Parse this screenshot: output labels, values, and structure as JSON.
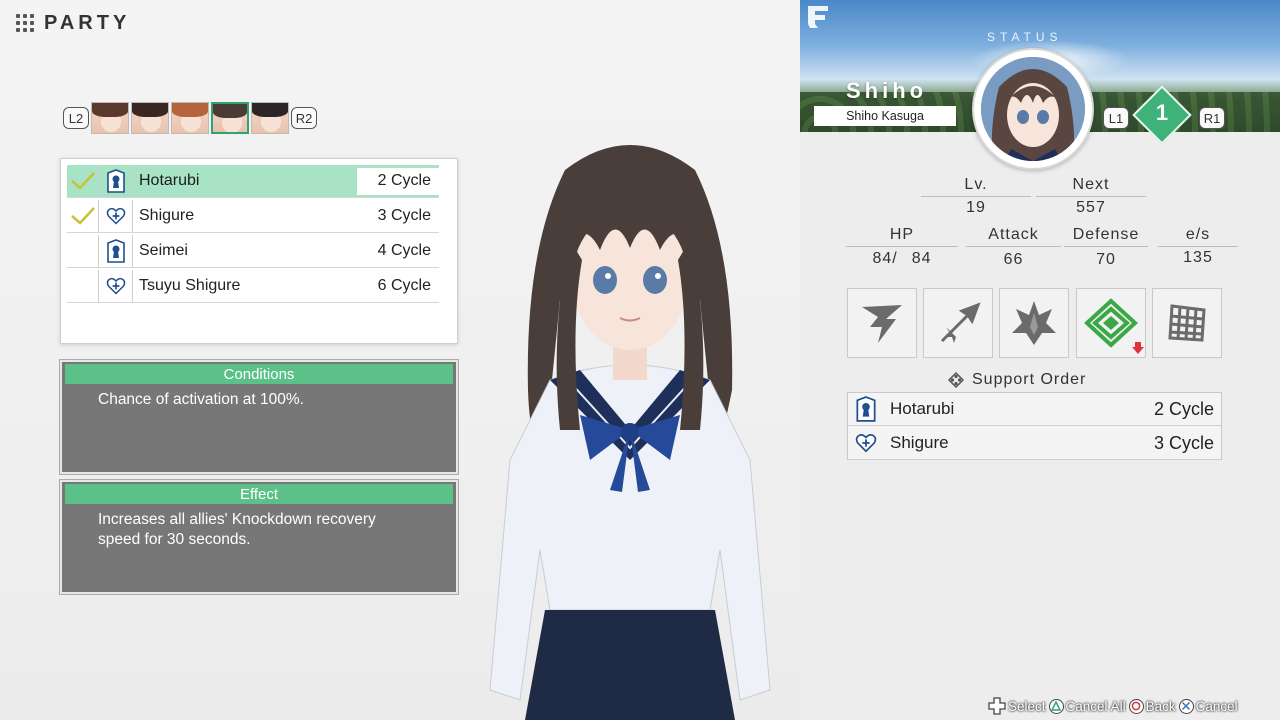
{
  "header": {
    "title": "PARTY",
    "icon": "grid-menu-icon"
  },
  "party": {
    "left_button": "L2",
    "right_button": "R2",
    "members": [
      {
        "hair": "#5b3a2c",
        "selected": false
      },
      {
        "hair": "#3a2722",
        "selected": false
      },
      {
        "hair": "#b4653d",
        "selected": false
      },
      {
        "hair": "#4a3b36",
        "selected": true
      },
      {
        "hair": "#2a2628",
        "selected": false
      }
    ]
  },
  "order_list": [
    {
      "name": "Hotarubi",
      "cycle": "2 Cycle",
      "checked": true,
      "active": true,
      "icon": "keyhole-tag-icon"
    },
    {
      "name": "Shigure",
      "cycle": "3 Cycle",
      "checked": true,
      "active": false,
      "icon": "heart-plus-icon"
    },
    {
      "name": "Seimei",
      "cycle": "4 Cycle",
      "checked": false,
      "active": false,
      "icon": "keyhole-tag-icon"
    },
    {
      "name": "Tsuyu Shigure",
      "cycle": "6 Cycle",
      "checked": false,
      "active": false,
      "icon": "heart-plus-icon"
    }
  ],
  "conditions": {
    "title": "Conditions",
    "text": "Chance of activation at 100%."
  },
  "effect": {
    "title": "Effect",
    "text": "Increases all allies' Knockdown recovery speed for 30 seconds."
  },
  "status": {
    "label": "STATUS",
    "name": "Shiho",
    "full_name": "Shiho Kasuga",
    "l_button": "L1",
    "r_button": "R1",
    "party_slot": "1",
    "lv_label": "Lv.",
    "lv": "19",
    "next_label": "Next",
    "next": "557",
    "hp_label": "HP",
    "hp_current": "84/",
    "hp_max": "84",
    "attack_label": "Attack",
    "attack": "66",
    "defense_label": "Defense",
    "defense": "70",
    "es_label": "e/s",
    "es": "135"
  },
  "skills": [
    {
      "icon": "slash-wing-icon",
      "color": "#666666"
    },
    {
      "icon": "arrow-burst-icon",
      "color": "#666666"
    },
    {
      "icon": "spike-burst-icon",
      "color": "#666666"
    },
    {
      "icon": "green-diamond-chevron-icon",
      "color": "#3aa845",
      "debuff": true
    },
    {
      "icon": "grid-net-icon",
      "color": "#666666"
    }
  ],
  "support": {
    "title": "Support Order",
    "rows": [
      {
        "name": "Hotarubi",
        "cycle": "2 Cycle",
        "icon": "keyhole-tag-icon"
      },
      {
        "name": "Shigure",
        "cycle": "3 Cycle",
        "icon": "heart-plus-icon"
      }
    ]
  },
  "footer": {
    "select": "Select",
    "cancel_all": "Cancel All",
    "back": "Back",
    "cancel": "Cancel"
  },
  "colors": {
    "accent_green": "#5cc089",
    "active_row": "#a8e3c5",
    "info_bg": "#777777",
    "icon_blue": "#1f4f8f"
  }
}
